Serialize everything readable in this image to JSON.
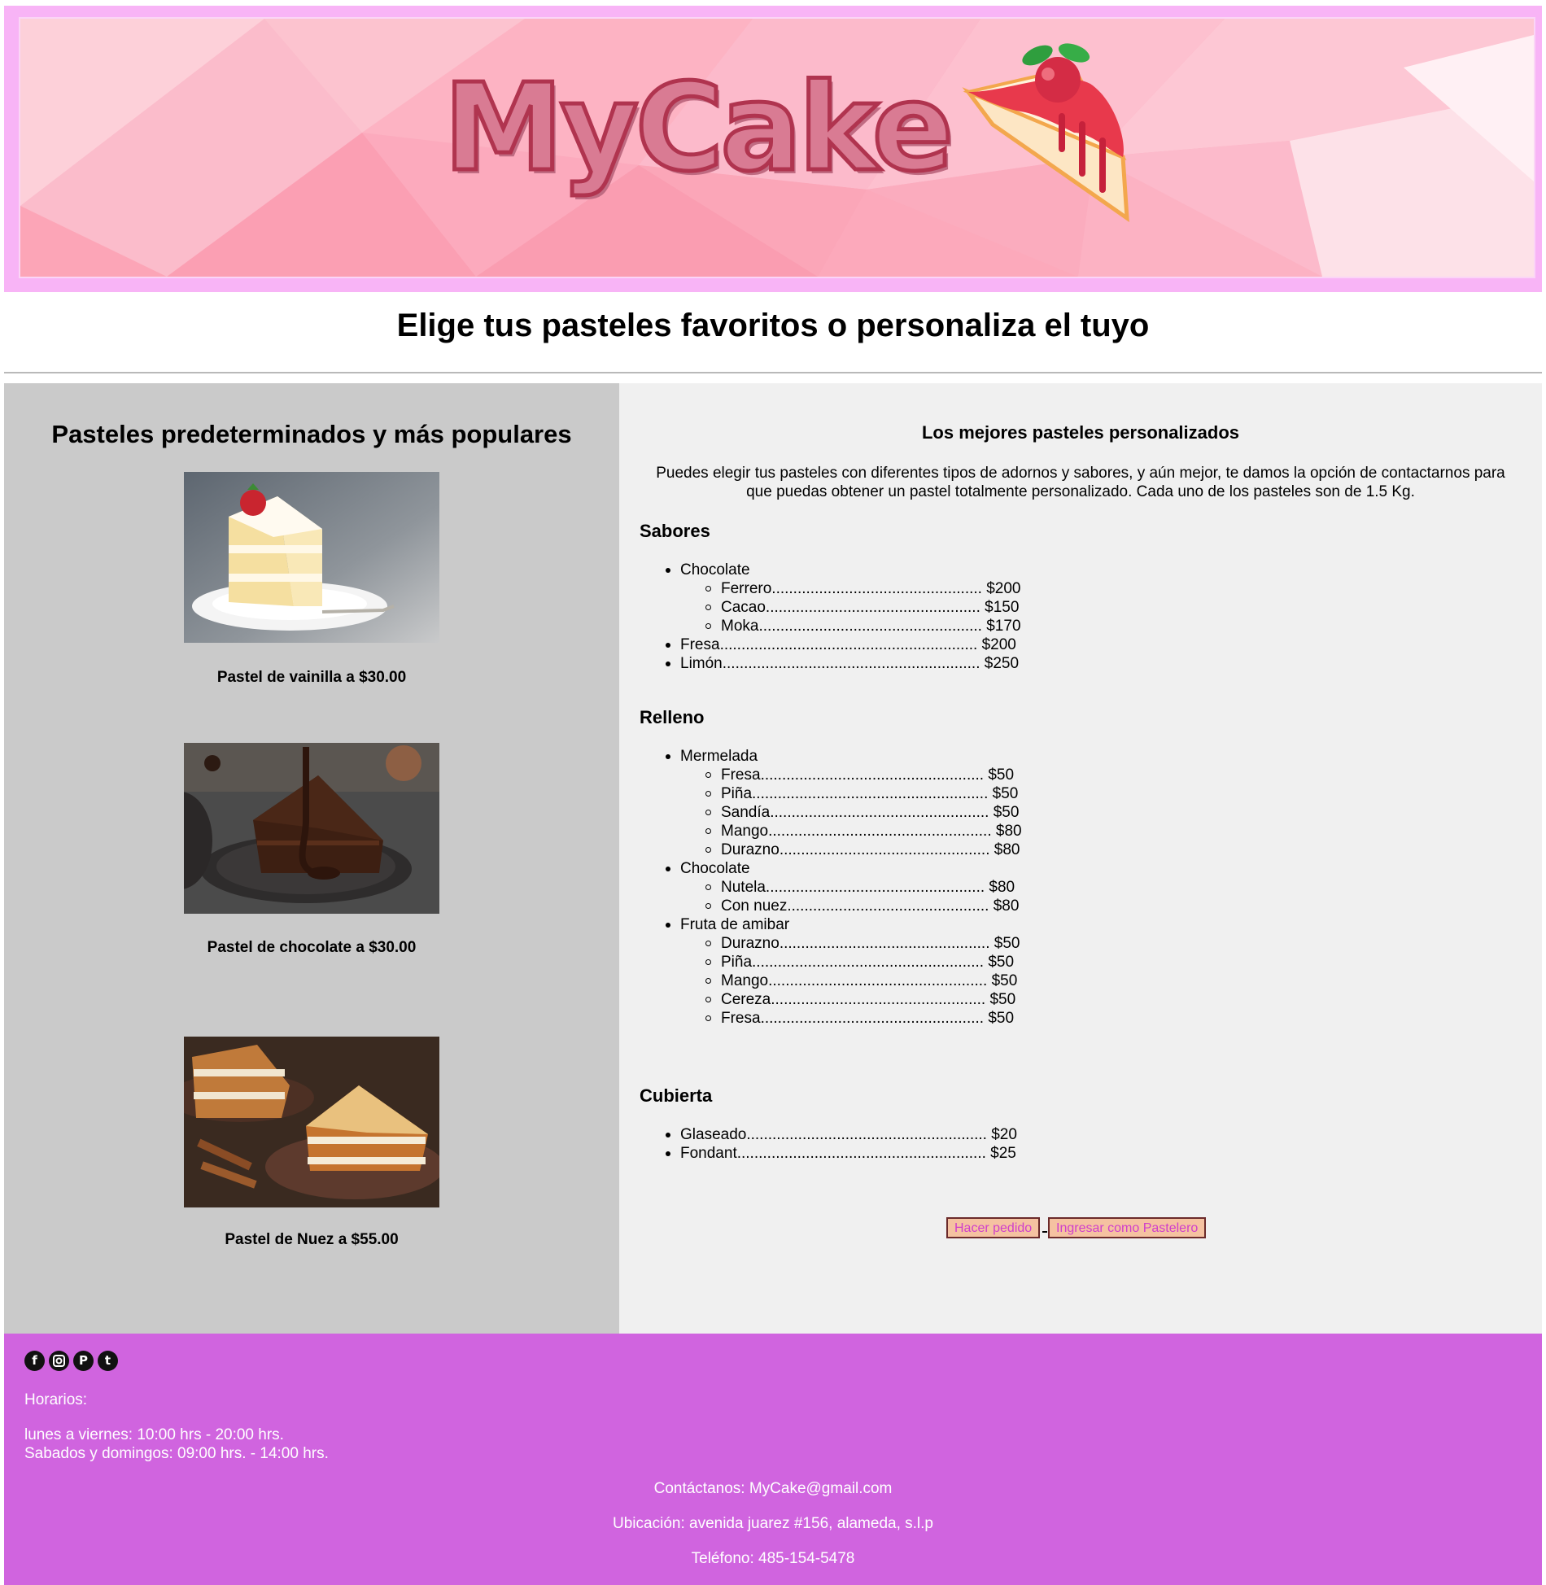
{
  "header": {
    "logo_text": "MyCake",
    "subtitle": "Elige tus pasteles favoritos o personaliza el tuyo"
  },
  "popular": {
    "title": "Pasteles predeterminados y más populares",
    "cakes": [
      {
        "caption": "Pastel de vainilla a $30.00",
        "image": "vanilla-cake-slice"
      },
      {
        "caption": "Pastel de chocolate a $30.00",
        "image": "chocolate-cake-slice"
      },
      {
        "caption": "Pastel de Nuez a $55.00",
        "image": "walnut-carrot-cake-slice"
      }
    ]
  },
  "custom": {
    "title": "Los mejores pasteles personalizados",
    "intro": "Puedes elegir tus pasteles con diferentes tipos de adornos y sabores, y aún mejor, te damos la opción de contactarnos para que puedas obtener un pastel totalmente personalizado. Cada uno de los pasteles son de 1.5 Kg.",
    "sabores": {
      "heading": "Sabores",
      "items": [
        "Chocolate",
        "Ferrero................................................. $200",
        "Cacao.................................................. $150",
        "Moka.................................................... $170",
        "Fresa............................................................ $200",
        "Limón............................................................ $250"
      ]
    },
    "relleno": {
      "heading": "Relleno",
      "items": [
        "Mermelada",
        "Fresa.................................................... $50",
        "Piña....................................................... $50",
        "Sandía................................................... $50",
        "Mango.................................................... $80",
        "Durazno................................................. $80",
        "Chocolate",
        "Nutela................................................... $80",
        "Con nuez............................................... $80",
        "Fruta de amibar",
        "Durazno................................................. $50",
        "Piña...................................................... $50",
        "Mango................................................... $50",
        "Cereza.................................................. $50",
        "Fresa.................................................... $50"
      ]
    },
    "cubierta": {
      "heading": "Cubierta",
      "items": [
        "Glaseado........................................................ $20",
        "Fondant.......................................................... $25"
      ]
    },
    "buttons": {
      "order": "Hacer pedido",
      "baker_login": "Ingresar como Pastelero"
    }
  },
  "footer": {
    "social_icons": [
      "facebook-icon",
      "instagram-icon",
      "pinterest-icon",
      "tumblr-icon"
    ],
    "hours_label": "Horarios:",
    "weekdays": "lunes a viernes: 10:00 hrs - 20:00 hrs.",
    "weekends": "Sabados y domingos: 09:00 hrs. - 14:00 hrs.",
    "contact": "Contáctanos: MyCake@gmail.com",
    "location": "Ubicación: avenida juarez #156, alameda, s.l.p",
    "phone": "Teléfono: 485-154-5478"
  },
  "colors": {
    "banner_frame": "#f8b4f6",
    "left_panel": "#cacaca",
    "right_panel": "#f0f0f0",
    "footer": "#d064df",
    "button_bg": "#f5c2a1",
    "button_text": "#d03fcb"
  }
}
